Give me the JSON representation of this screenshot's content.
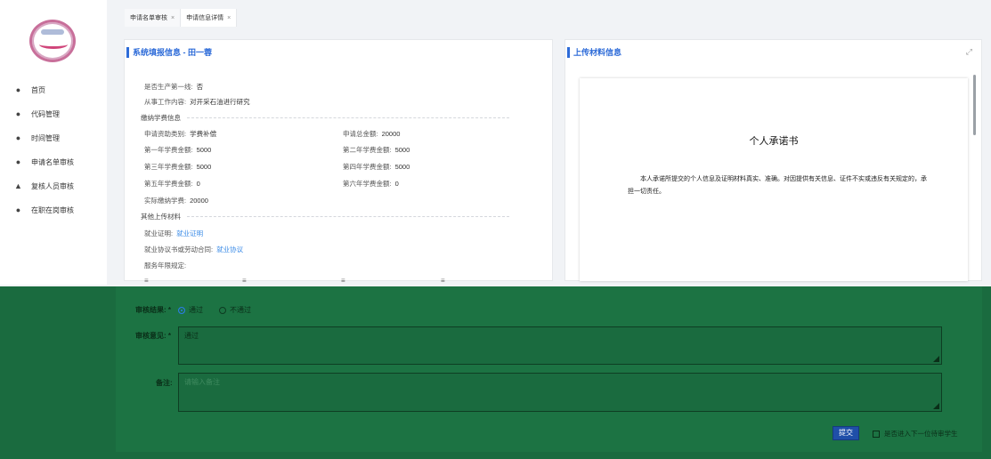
{
  "nav": {
    "items": [
      {
        "label": "首页",
        "icon": "home-icon"
      },
      {
        "label": "代码管理",
        "icon": "code-icon"
      },
      {
        "label": "时间管理",
        "icon": "clock-icon"
      },
      {
        "label": "申请名单审核",
        "icon": "list-icon"
      },
      {
        "label": "复核人员审核",
        "icon": "user-icon"
      },
      {
        "label": "在职在岗审核",
        "icon": "briefcase-icon"
      }
    ]
  },
  "tabs": [
    {
      "label": "申请名单审核",
      "close": "×"
    },
    {
      "label": "申请信息详情",
      "close": "×"
    }
  ],
  "left_panel": {
    "title": "系统填报信息 - 田一蓉",
    "fields": {
      "first_line": {
        "label": "是否生产第一线:",
        "value": "否"
      },
      "work_content": {
        "label": "从事工作内容:",
        "value": "对开采石油进行研究"
      },
      "tuition_section": "缴纳学费信息",
      "subsidy_type": {
        "label": "申请资助类别:",
        "value": "学费补偿"
      },
      "total_amount": {
        "label": "申请总金额:",
        "value": "20000"
      },
      "year1": {
        "label": "第一年学费金额:",
        "value": "5000"
      },
      "year2": {
        "label": "第二年学费金额:",
        "value": "5000"
      },
      "year3": {
        "label": "第三年学费金额:",
        "value": "5000"
      },
      "year4": {
        "label": "第四年学费金额:",
        "value": "5000"
      },
      "year5": {
        "label": "第五年学费金额:",
        "value": "0"
      },
      "year6": {
        "label": "第六年学费金额:",
        "value": "0"
      },
      "actual_paid": {
        "label": "实际缴纳学费:",
        "value": "20000"
      },
      "other_section": "其他上传材料",
      "employment_proof": {
        "label": "就业证明:",
        "link": "就业证明"
      },
      "employment_agreement": {
        "label": "就业协议书或劳动合同:",
        "link": "就业协议"
      },
      "service_years": {
        "label": "服务年限规定:"
      }
    }
  },
  "right_panel": {
    "title": "上传材料信息",
    "doc_title": "个人承诺书",
    "doc_body": "本人承诺所提交的个人信息及证明材料真实、准确。对因提供有关信息、证件不实或违反有关规定的，承担一切责任。"
  },
  "review": {
    "result_label": "审核结果: *",
    "pass_label": "通过",
    "fail_label": "不通过",
    "selected": "通过",
    "opinion_label": "审核意见: *",
    "opinion_value": "通过",
    "remark_label": "备注:",
    "remark_placeholder": "请输入备注",
    "submit_label": "提交",
    "next_label": "是否进入下一位待审学生"
  },
  "colors": {
    "accent": "#2d6bd8",
    "link": "#3c8ce7",
    "review_bg": "#1c7343"
  }
}
